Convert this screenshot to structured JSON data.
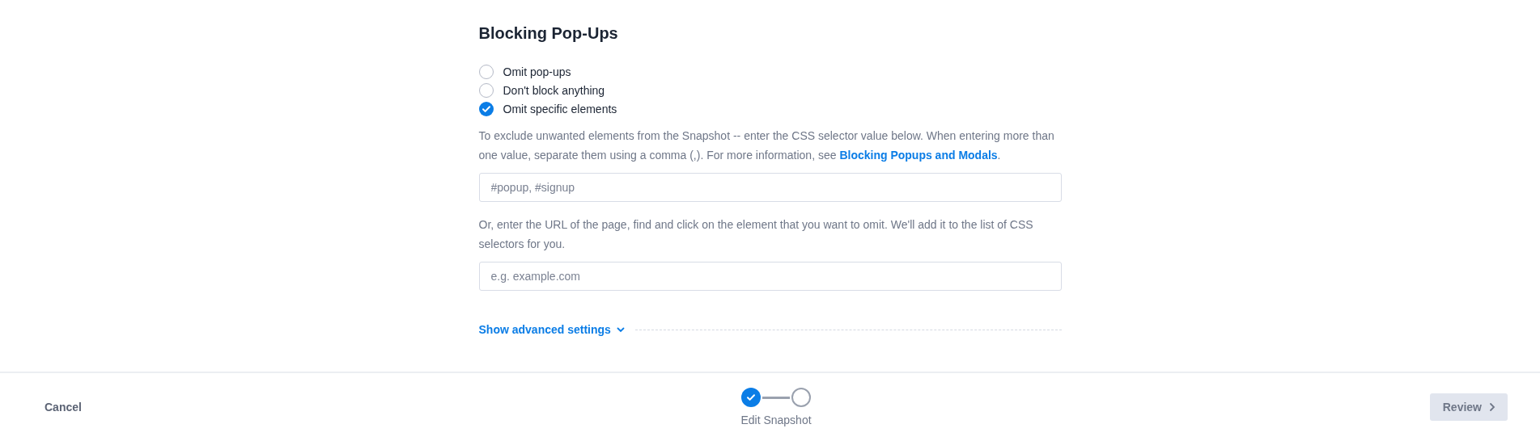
{
  "section": {
    "title": "Blocking Pop-Ups",
    "options": [
      {
        "label": "Omit pop-ups",
        "selected": false
      },
      {
        "label": "Don't block anything",
        "selected": false
      },
      {
        "label": "Omit specific elements",
        "selected": true
      }
    ],
    "help": {
      "before": "To exclude unwanted elements from the Snapshot -- enter the CSS selector value below. When entering more than one value, separate them using a comma (,). For more information, see ",
      "link": "Blocking Popups and Modals",
      "after": "."
    },
    "selector_field": {
      "placeholder": "#popup, #signup"
    },
    "url_help": "Or, enter the URL of the page, find and click on the element that you want to omit. We'll add it to the list of CSS selectors for you.",
    "url_field": {
      "placeholder": "e.g. example.com"
    },
    "advanced": {
      "label": "Show advanced settings",
      "expanded": false
    }
  },
  "footer": {
    "cancel": "Cancel",
    "steps": [
      {
        "done": true
      },
      {
        "done": false
      }
    ],
    "step_label": "Edit Snapshot",
    "review": {
      "label": "Review",
      "disabled": true
    }
  }
}
